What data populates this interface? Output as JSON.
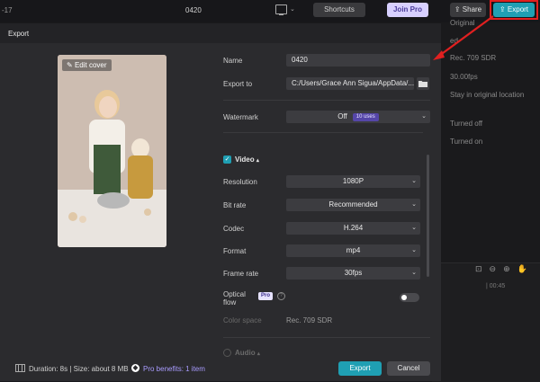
{
  "topbar": {
    "left_text": "-17",
    "project_title": "0420",
    "shortcuts_label": "Shortcuts",
    "join_pro_label": "Join Pro",
    "share_label": "Share",
    "export_label": "Export"
  },
  "side_panel": {
    "items": [
      "Original",
      "ed",
      "Rec. 709 SDR",
      "30.00fps",
      "Stay in original location",
      "Turned off",
      "Turned on"
    ]
  },
  "timeline": {
    "time": "| 00:45"
  },
  "dialog": {
    "title": "Export",
    "edit_cover_label": "Edit cover",
    "name_label": "Name",
    "name_value": "0420",
    "export_to_label": "Export to",
    "export_to_value": "C:/Users/Grace Ann Sigua/AppData/...",
    "watermark_label": "Watermark",
    "watermark_value": "Off",
    "watermark_badge": "10 uses",
    "video_label": "Video",
    "resolution_label": "Resolution",
    "resolution_value": "1080P",
    "bitrate_label": "Bit rate",
    "bitrate_value": "Recommended",
    "codec_label": "Codec",
    "codec_value": "H.264",
    "format_label": "Format",
    "format_value": "mp4",
    "framerate_label": "Frame rate",
    "framerate_value": "30fps",
    "optical_label_1": "Optical",
    "optical_label_2": "flow",
    "pro_badge": "Pro",
    "colorspace_label": "Color space",
    "colorspace_value": "Rec. 709 SDR",
    "audio_label": "Audio",
    "footer_info": "Duration: 8s | Size: about 8 MB",
    "pro_benefits": "Pro benefits: 1 item",
    "export_button": "Export",
    "cancel_button": "Cancel"
  },
  "colors": {
    "accent": "#1f9fb3",
    "pro": "#a99cff",
    "annotation": "#e02020"
  }
}
